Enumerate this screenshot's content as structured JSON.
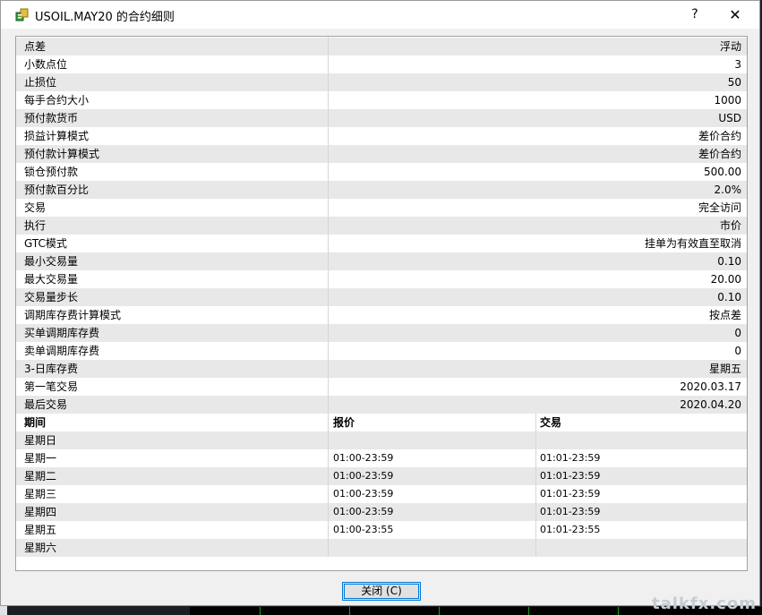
{
  "window": {
    "title": "USOIL.MAY20 的合约细则",
    "help_label": "?",
    "close_label": "✕"
  },
  "properties": [
    {
      "name": "点差",
      "value": "浮动"
    },
    {
      "name": "小数点位",
      "value": "3"
    },
    {
      "name": "止损位",
      "value": "50"
    },
    {
      "name": "每手合约大小",
      "value": "1000"
    },
    {
      "name": "预付款货币",
      "value": "USD"
    },
    {
      "name": "损益计算模式",
      "value": "差价合约"
    },
    {
      "name": "预付款计算模式",
      "value": "差价合约"
    },
    {
      "name": "锁仓预付款",
      "value": "500.00"
    },
    {
      "name": "预付款百分比",
      "value": "2.0%"
    },
    {
      "name": "交易",
      "value": "完全访问"
    },
    {
      "name": "执行",
      "value": "市价"
    },
    {
      "name": "GTC模式",
      "value": "挂单为有效直至取消"
    },
    {
      "name": "最小交易量",
      "value": "0.10"
    },
    {
      "name": "最大交易量",
      "value": "20.00"
    },
    {
      "name": "交易量步长",
      "value": "0.10"
    },
    {
      "name": "调期库存费计算模式",
      "value": "按点差"
    },
    {
      "name": "买单调期库存费",
      "value": "0"
    },
    {
      "name": "卖单调期库存费",
      "value": "0"
    },
    {
      "name": "3-日库存费",
      "value": "星期五"
    },
    {
      "name": "第一笔交易",
      "value": "2020.03.17"
    },
    {
      "name": "最后交易",
      "value": "2020.04.20"
    }
  ],
  "sessions": {
    "headers": {
      "period": "期间",
      "quote": "报价",
      "trade": "交易"
    },
    "rows": [
      {
        "day": "星期日",
        "quote": "",
        "trade": ""
      },
      {
        "day": "星期一",
        "quote": "01:00-23:59",
        "trade": "01:01-23:59"
      },
      {
        "day": "星期二",
        "quote": "01:00-23:59",
        "trade": "01:01-23:59"
      },
      {
        "day": "星期三",
        "quote": "01:00-23:59",
        "trade": "01:01-23:59"
      },
      {
        "day": "星期四",
        "quote": "01:00-23:59",
        "trade": "01:01-23:59"
      },
      {
        "day": "星期五",
        "quote": "01:00-23:55",
        "trade": "01:01-23:55"
      },
      {
        "day": "星期六",
        "quote": "",
        "trade": ""
      }
    ]
  },
  "footer": {
    "close_button": "关闭 (C)"
  },
  "watermark": "talkfx.com",
  "colors": {
    "accent": "#0078d7",
    "alt_row": "#e8e8e8",
    "dialog_bg": "#f0f0f0"
  }
}
